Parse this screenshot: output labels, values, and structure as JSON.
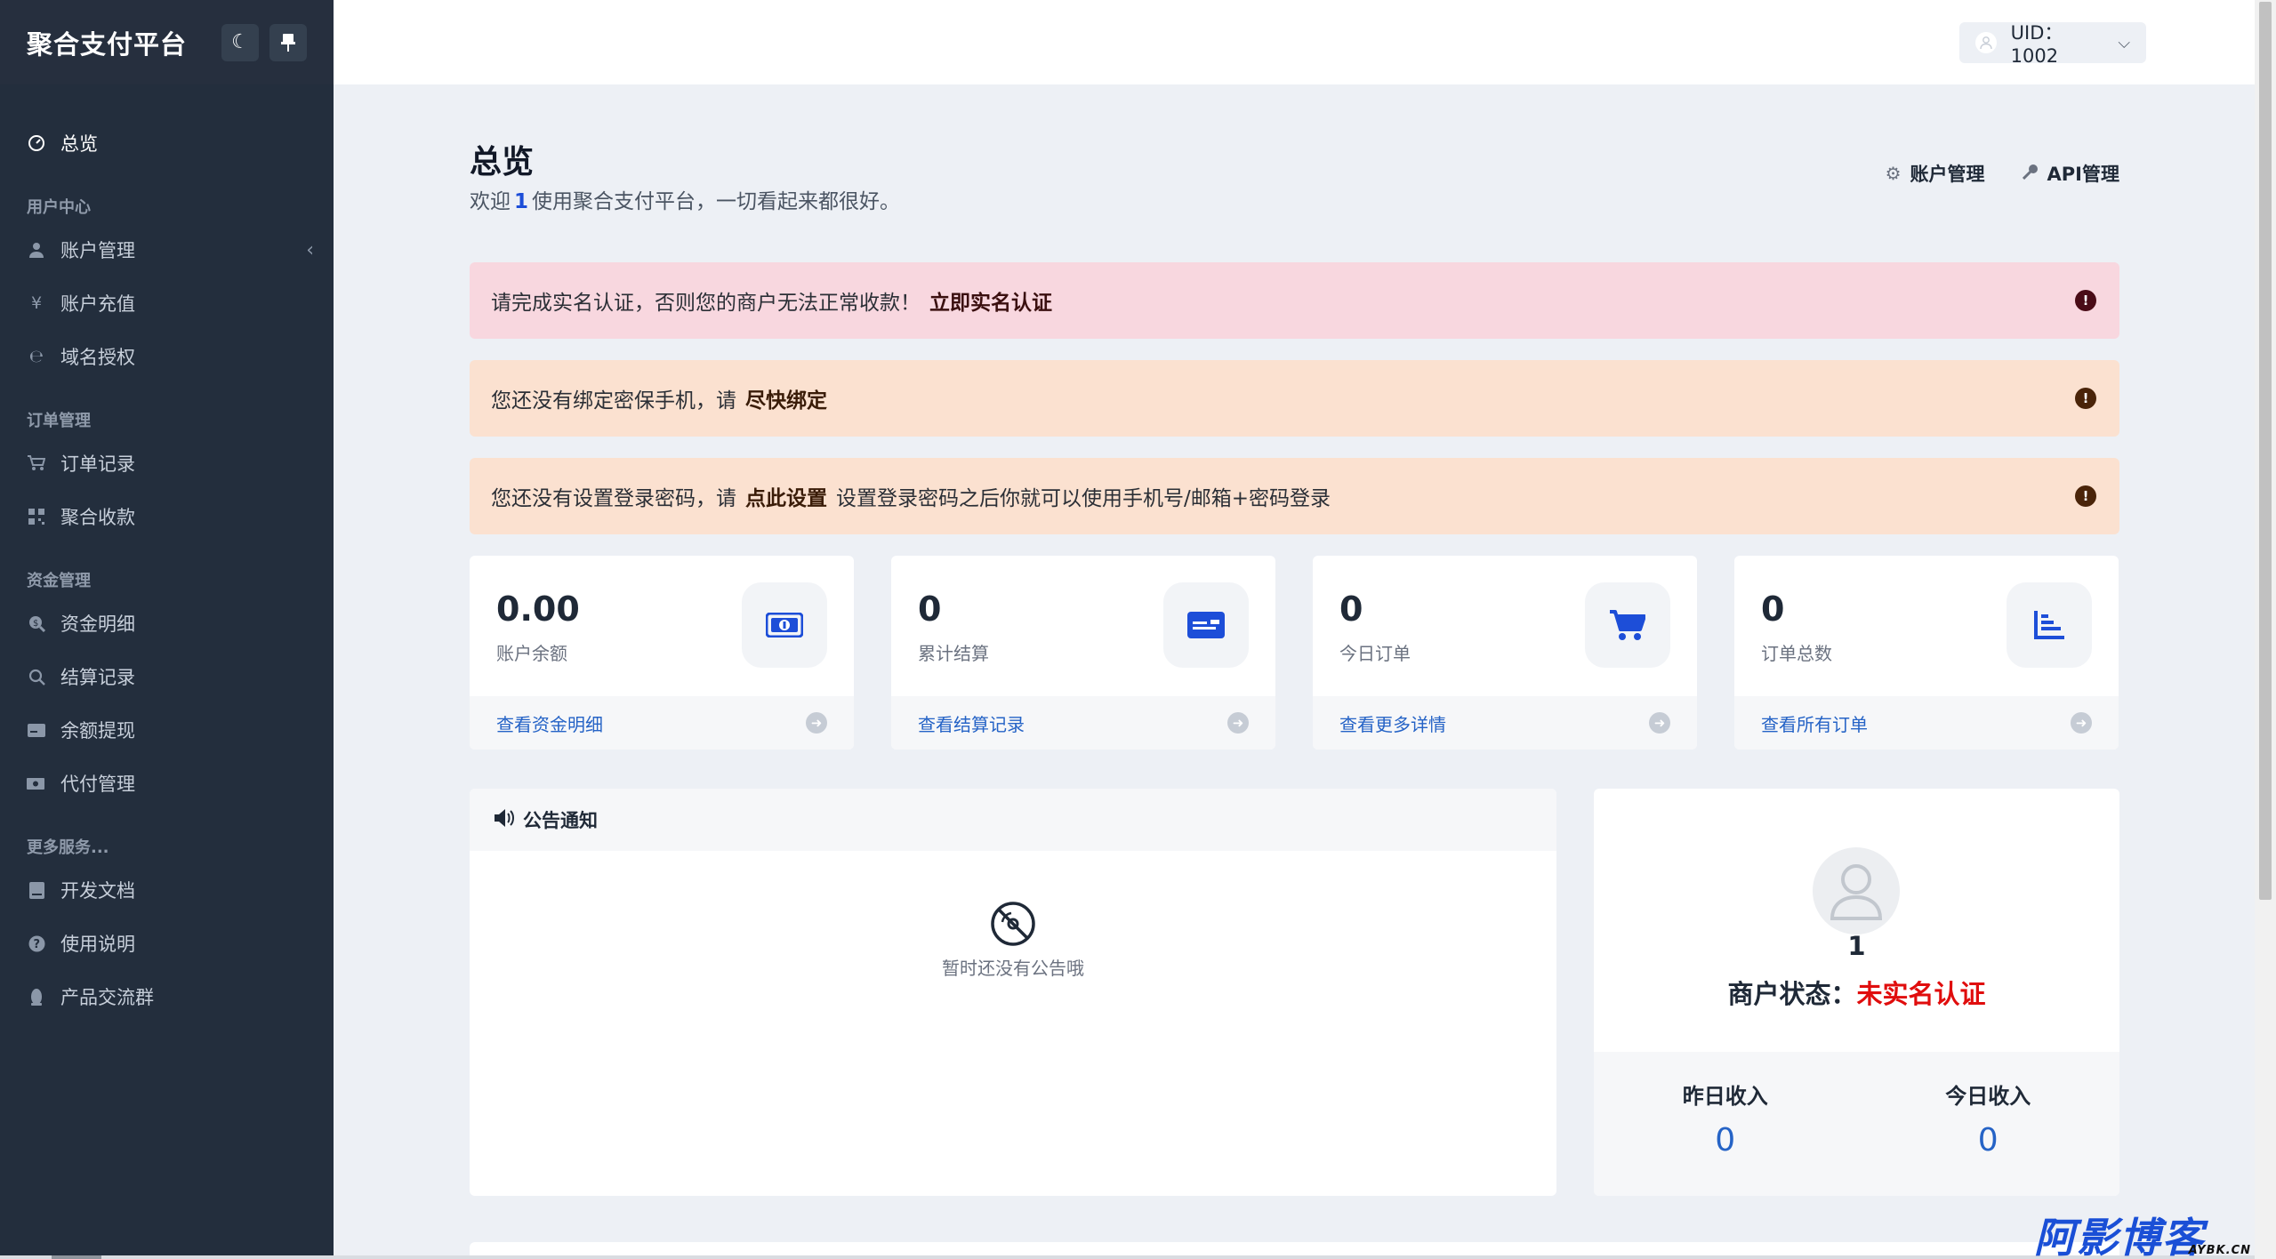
{
  "brand": {
    "title": "聚合支付平台"
  },
  "topbar": {
    "uid_label": "UID：1002"
  },
  "sidebar": {
    "overview": "总览",
    "sections": [
      {
        "title": "用户中心",
        "items": [
          {
            "label": "账户管理",
            "icon": "user-icon"
          },
          {
            "label": "账户充值",
            "icon": "yen-icon"
          },
          {
            "label": "域名授权",
            "icon": "ie-icon"
          }
        ]
      },
      {
        "title": "订单管理",
        "items": [
          {
            "label": "订单记录",
            "icon": "cart-icon"
          },
          {
            "label": "聚合收款",
            "icon": "qrcode-icon"
          }
        ]
      },
      {
        "title": "资金管理",
        "items": [
          {
            "label": "资金明细",
            "icon": "search-dollar-icon"
          },
          {
            "label": "结算记录",
            "icon": "search-icon"
          },
          {
            "label": "余额提现",
            "icon": "card-icon"
          },
          {
            "label": "代付管理",
            "icon": "money-icon"
          }
        ]
      },
      {
        "title": "更多服务...",
        "items": [
          {
            "label": "开发文档",
            "icon": "book-icon"
          },
          {
            "label": "使用说明",
            "icon": "question-icon"
          },
          {
            "label": "产品交流群",
            "icon": "penguin-icon"
          }
        ]
      }
    ]
  },
  "header": {
    "title": "总览",
    "subtitle_pre": "欢迎",
    "subtitle_uid": "1",
    "subtitle_post": "使用聚合支付平台，一切看起来都很好。",
    "actions": [
      "账户管理",
      "API管理"
    ]
  },
  "alerts": [
    {
      "text": "请完成实名认证，否则您的商户无法正常收款！",
      "link": "立即实名认证",
      "after": ""
    },
    {
      "text": "您还没有绑定密保手机，请",
      "link": "尽快绑定",
      "after": ""
    },
    {
      "text": "您还没有设置登录密码，请",
      "link": "点此设置",
      "after": "设置登录密码之后你就可以使用手机号/邮箱+密码登录"
    }
  ],
  "stats": [
    {
      "value": "0.00",
      "label": "账户余额",
      "link": "查看资金明细",
      "icon": "money-bill-icon"
    },
    {
      "value": "0",
      "label": "累计结算",
      "link": "查看结算记录",
      "icon": "id-card-icon"
    },
    {
      "value": "0",
      "label": "今日订单",
      "link": "查看更多详情",
      "icon": "cart-icon"
    },
    {
      "value": "0",
      "label": "订单总数",
      "link": "查看所有订单",
      "icon": "bar-chart-icon"
    }
  ],
  "notice": {
    "title": "公告通知",
    "empty": "暂时还没有公告哦"
  },
  "merchant": {
    "name": "1",
    "status_label": "商户状态：",
    "status_value": "未实名认证",
    "yesterday_label": "昨日收入",
    "yesterday_value": "0",
    "today_label": "今日收入",
    "today_value": "0"
  },
  "watermark": {
    "main": "阿影博客",
    "sub": "AYBK.CN"
  },
  "colors": {
    "sidebar_bg": "#232e3d",
    "link": "#2563c6",
    "danger": "#e00d0d",
    "stat_icon": "#1d4ed8"
  }
}
